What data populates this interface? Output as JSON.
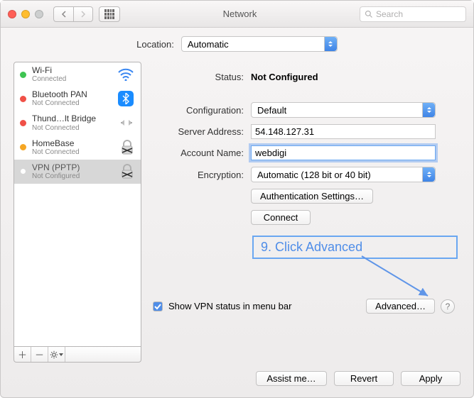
{
  "window": {
    "title": "Network",
    "search_placeholder": "Search"
  },
  "location": {
    "label": "Location:",
    "value": "Automatic"
  },
  "services": [
    {
      "name": "Wi-Fi",
      "status": "Connected",
      "dot": "green",
      "icon": "wifi"
    },
    {
      "name": "Bluetooth PAN",
      "status": "Not Connected",
      "dot": "red",
      "icon": "bluetooth"
    },
    {
      "name": "Thund…lt Bridge",
      "status": "Not Connected",
      "dot": "red",
      "icon": "thunderbolt"
    },
    {
      "name": "HomeBase",
      "status": "Not Connected",
      "dot": "orange",
      "icon": "lock"
    },
    {
      "name": "VPN (PPTP)",
      "status": "Not Configured",
      "dot": "white",
      "icon": "lock",
      "selected": true
    }
  ],
  "detail": {
    "status_label": "Status:",
    "status_value": "Not Configured",
    "config_label": "Configuration:",
    "config_value": "Default",
    "server_label": "Server Address:",
    "server_value": "54.148.127.31",
    "account_label": "Account Name:",
    "account_value": "webdigi",
    "encryption_label": "Encryption:",
    "encryption_value": "Automatic (128 bit or 40 bit)",
    "auth_button": "Authentication Settings…",
    "connect_button": "Connect",
    "show_vpn_label": "Show VPN status in menu bar",
    "advanced_button": "Advanced…"
  },
  "annotation": "9. Click Advanced",
  "footer": {
    "assist": "Assist me…",
    "revert": "Revert",
    "apply": "Apply"
  }
}
